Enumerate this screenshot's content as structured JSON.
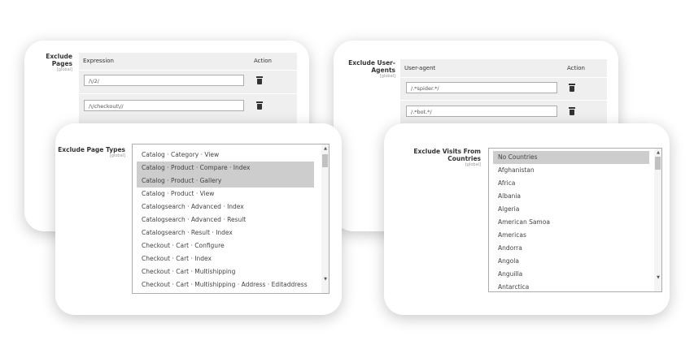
{
  "exclude_pages": {
    "label": "Exclude Pages",
    "scope": "[global]",
    "col_expression": "Expression",
    "col_action": "Action",
    "rows": [
      "/\\/2/",
      "/\\/checkout\\//"
    ]
  },
  "exclude_user_agents": {
    "label": "Exclude User-Agents",
    "scope": "[global]",
    "col_agent": "User-agent",
    "col_action": "Action",
    "rows": [
      "/.*spider.*/",
      "/.*bot.*/"
    ]
  },
  "exclude_page_types": {
    "label": "Exclude Page Types",
    "scope": "[global]",
    "options": [
      "Catalog · Category · View",
      "Catalog · Product · Compare · Index",
      "Catalog · Product · Gallery",
      "Catalog · Product · View",
      "Catalogsearch · Advanced · Index",
      "Catalogsearch · Advanced · Result",
      "Catalogsearch · Result · Index",
      "Checkout · Cart · Configure",
      "Checkout · Cart · Index",
      "Checkout · Cart · Multishipping",
      "Checkout · Cart · Multishipping · Address · Editaddress"
    ],
    "selected": [
      1,
      2
    ]
  },
  "exclude_countries": {
    "label": "Exclude Visits From Countries",
    "scope": "[global]",
    "options": [
      "No Countries",
      "Afghanistan",
      "Africa",
      "Albania",
      "Algeria",
      "American Samoa",
      "Americas",
      "Andorra",
      "Angola",
      "Anguilla",
      "Antarctica"
    ],
    "selected": [
      0
    ]
  }
}
